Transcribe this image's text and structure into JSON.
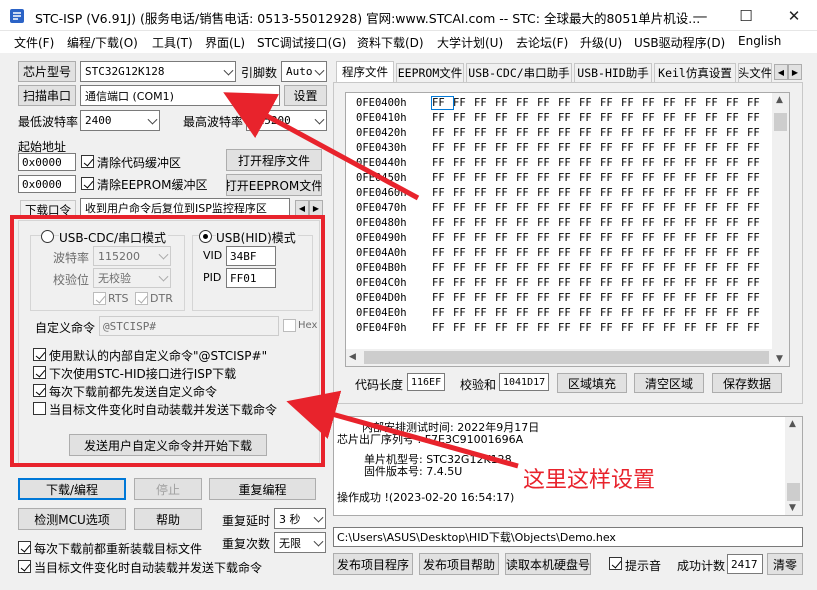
{
  "window": {
    "title": "STC-ISP (V6.91J) (服务电话/销售电话: 0513-55012928) 官网:www.STCAI.com  -- STC: 全球最大的8051单片机设...",
    "minimize": "—",
    "maximize": "☐",
    "close": "✕"
  },
  "menu": [
    "文件(F)",
    "编程/下载(O)",
    "工具(T)",
    "界面(L)",
    "STC调试接口(G)",
    "资料下载(D)",
    "大学计划(U)",
    "去论坛(F)",
    "升级(U)",
    "USB驱动程序(D)",
    "English"
  ],
  "left": {
    "chip_type_btn": "芯片型号",
    "chip_type_value": "STC32G12K128",
    "pin_count_label": "引脚数",
    "pin_count_value": "Auto",
    "scan_port_btn": "扫描串口",
    "port_value": "通信端口 (COM1)",
    "settings_btn": "设置",
    "min_baud_label": "最低波特率",
    "min_baud_value": "2400",
    "max_baud_label": "最高波特率",
    "max_baud_value": "115200",
    "start_addr_label": "起始地址",
    "code_addr": "0x0000",
    "clear_code_label": "清除代码缓冲区",
    "open_program_btn": "打开程序文件",
    "eeprom_addr": "0x0000",
    "clear_eeprom_label": "清除EEPROM缓冲区",
    "open_eeprom_btn": "打开EEPROM文件",
    "download_tab_label": "下载口令",
    "reset_cmd_value": "收到用户命令后复位到ISP监控程序区"
  },
  "usb_panel": {
    "cdc_mode_label": "USB-CDC/串口模式",
    "hid_mode_label": "USB(HID)模式",
    "baud_label": "波特率",
    "baud_value": "115200",
    "parity_label": "校验位",
    "parity_value": "无校验",
    "rts_label": "RTS",
    "dtr_label": "DTR",
    "vid_label": "VID",
    "vid_value": "34BF",
    "pid_label": "PID",
    "pid_value": "FF01",
    "custom_cmd_label": "自定义命令",
    "custom_cmd_value": "@STCISP#",
    "hex_label": "Hex",
    "opt1": "使用默认的内部自定义命令\"@STCISP#\"",
    "opt2": "下次使用STC-HID接口进行ISP下载",
    "opt3": "每次下载前都先发送自定义命令",
    "opt4": "当目标文件变化时自动装载并发送下载命令",
    "send_btn": "发送用户自定义命令并开始下载"
  },
  "bottom_left": {
    "download_btn": "下载/编程",
    "stop_btn": "停止",
    "reprogram_btn": "重复编程",
    "check_mcu_btn": "检测MCU选项",
    "help_btn": "帮助",
    "repeat_delay_label": "重复延时",
    "repeat_delay_value": "3 秒",
    "repeat_count_label": "重复次数",
    "repeat_count_value": "无限",
    "reload_label": "每次下载前都重新装载目标文件",
    "auto_reload_label": "当目标文件变化时自动装载并发送下载命令"
  },
  "tabs": [
    "程序文件",
    "EEPROM文件",
    "USB-CDC/串口助手",
    "USB-HID助手",
    "Keil仿真设置",
    "头文件"
  ],
  "hex": {
    "addresses": [
      "0FE0400h",
      "0FE0410h",
      "0FE0420h",
      "0FE0430h",
      "0FE0440h",
      "0FE0450h",
      "0FE0460h",
      "0FE0470h",
      "0FE0480h",
      "0FE0490h",
      "0FE04A0h",
      "0FE04B0h",
      "0FE04C0h",
      "0FE04D0h",
      "0FE04E0h",
      "0FE04F0h"
    ],
    "byte": "FF"
  },
  "code_bar": {
    "code_len_label": "代码长度",
    "code_len_value": "116EF",
    "checksum_label": "校验和",
    "checksum_value": "1041D17",
    "fill_btn": "区域填充",
    "clear_btn": "清空区域",
    "save_btn": "保存数据"
  },
  "log": {
    "line1": "内部安排测试时间: 2022年9月17日",
    "line2": "芯片出厂序列号 : F7E3C91001696A",
    "line3": "单片机型号: STC32G12K128",
    "line4": "固件版本号: 7.4.5U",
    "line5": "操作成功 !(2023-02-20 16:54:17)"
  },
  "path_value": "C:\\Users\\ASUS\\Desktop\\HID下载\\Objects\\Demo.hex",
  "bottom_bar": {
    "publish_btn": "发布项目程序",
    "publish_help_btn": "发布项目帮助",
    "read_disk_btn": "读取本机硬盘号",
    "beep_label": "提示音",
    "success_count_label": "成功计数",
    "success_count_value": "2417",
    "clear_btn": "清零"
  },
  "annotation": "这里这样设置",
  "colors": {
    "annotation_red": "#e8232c",
    "focus_blue": "#0078d7"
  }
}
